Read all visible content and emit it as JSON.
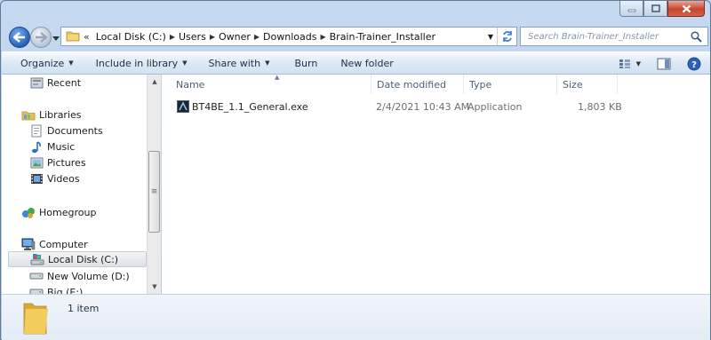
{
  "address": {
    "crumbs": [
      "Local Disk (C:)",
      "Users",
      "Owner",
      "Downloads",
      "Brain-Trainer_Installer"
    ],
    "overflow": "«"
  },
  "search": {
    "placeholder": "Search Brain-Trainer_Installer"
  },
  "toolbar": {
    "organize": "Organize",
    "include_in_library": "Include in library",
    "share_with": "Share with",
    "burn": "Burn",
    "new_folder": "New folder"
  },
  "nav": {
    "recent": "Recent",
    "libraries": "Libraries",
    "documents": "Documents",
    "music": "Music",
    "pictures": "Pictures",
    "videos": "Videos",
    "homegroup": "Homegroup",
    "computer": "Computer",
    "local_disk": "Local Disk (C:)",
    "new_volume": "New Volume (D:)",
    "big": "Big (E:)"
  },
  "columns": {
    "name": "Name",
    "date_modified": "Date modified",
    "type": "Type",
    "size": "Size"
  },
  "files": [
    {
      "name": "BT4BE_1.1_General.exe",
      "date_modified": "2/4/2021 10:43 AM",
      "type": "Application",
      "size": "1,803 KB"
    }
  ],
  "details": {
    "count": "1 item"
  },
  "icons": {
    "back": "back-arrow-icon",
    "forward": "forward-arrow-icon",
    "refresh": "refresh-icon",
    "search": "search-icon",
    "views": "views-icon",
    "preview_pane": "preview-pane-icon",
    "help": "help-icon"
  },
  "colors": {
    "accent": "#2460b4",
    "toolbar_text": "#1e2f45",
    "header_text": "#4c607a"
  }
}
